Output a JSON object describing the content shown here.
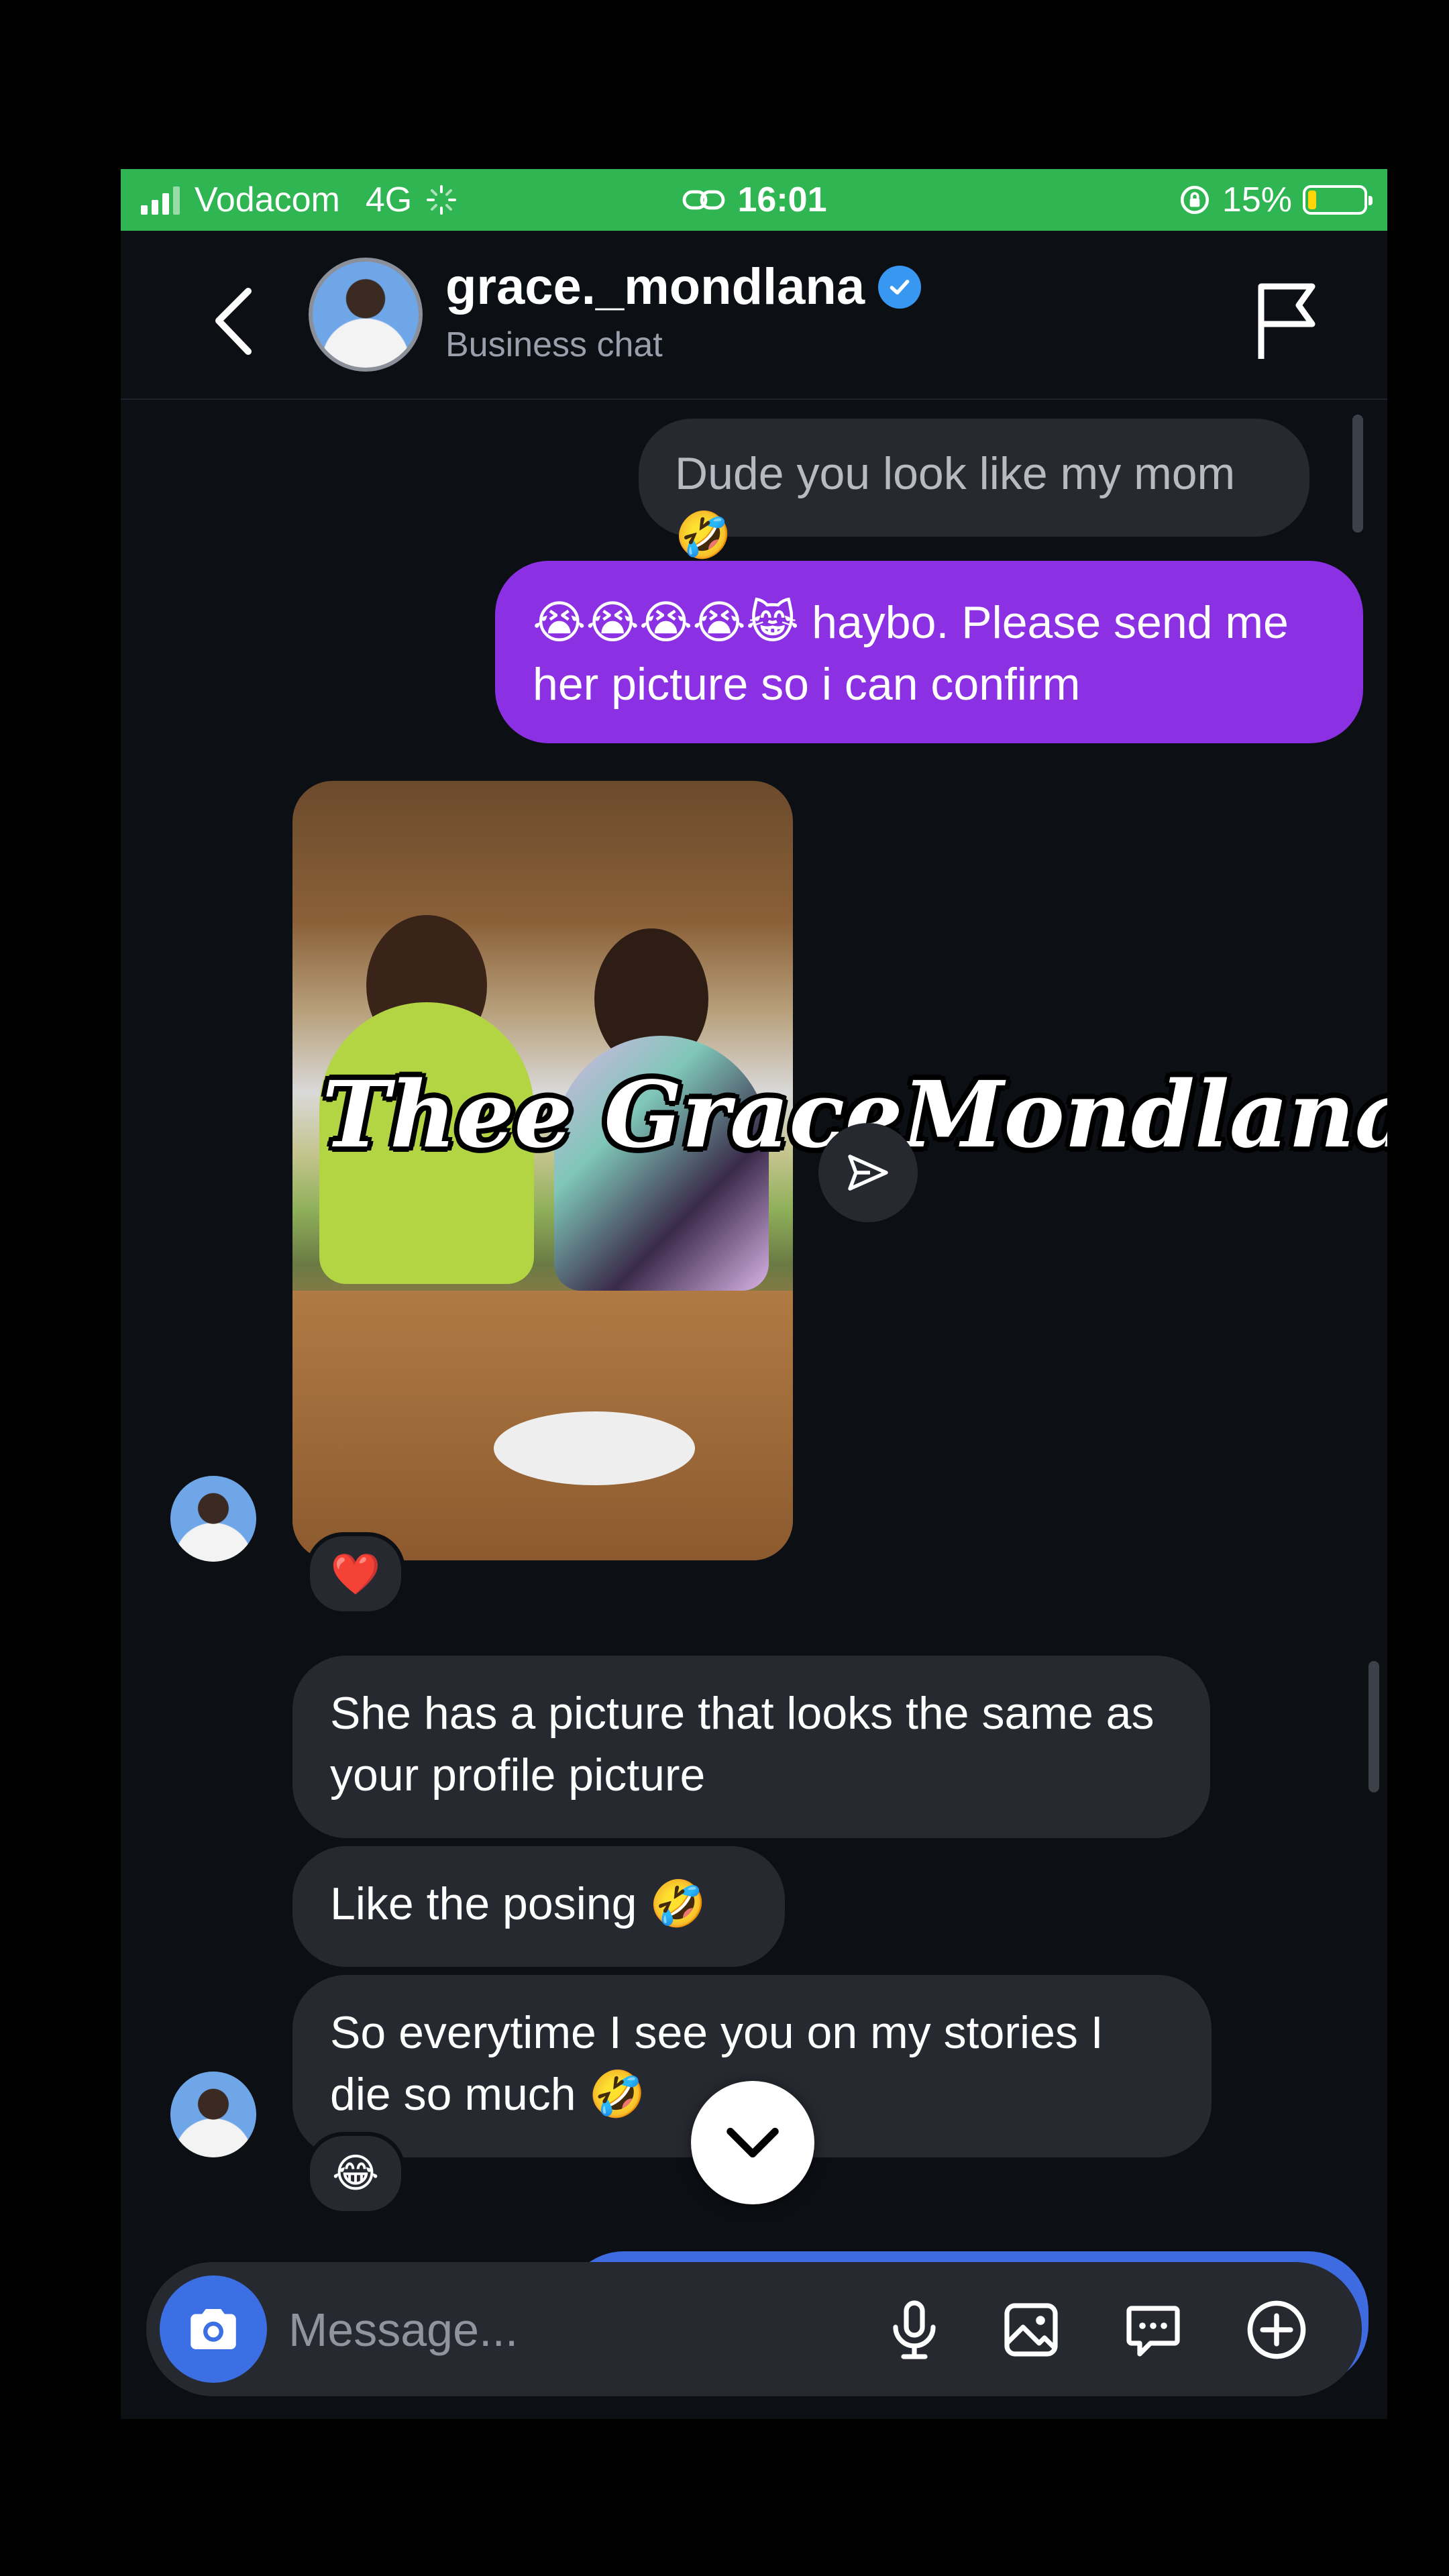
{
  "status_bar": {
    "carrier": "Vodacom",
    "network": "4G",
    "time": "16:01",
    "battery": "15%",
    "battery_level": 0.15,
    "bar_color": "#2fb652"
  },
  "header": {
    "username": "grace._mondlana",
    "subtitle": "Business chat",
    "verified": true
  },
  "messages": {
    "m1": "Dude you look like my mom🤣",
    "m2": "😭😭😭😭😹 haybo. Please send me her picture so i can confirm",
    "photo_caption": "Thee GraceMondlana🥰",
    "photo_reaction": "❤️",
    "m3": "She has a picture that looks the same as your profile picture",
    "m4": "Like the posing 🤣",
    "m5": "So everytime I see you on my stories I die so much 🤣",
    "m5_reaction": "😂"
  },
  "composer": {
    "placeholder": "Message..."
  },
  "colors": {
    "outgoing": "#8b31e3",
    "incoming": "#262930",
    "accent": "#3b6fe3",
    "background": "#0c0f14"
  },
  "icons": [
    "back-icon",
    "verified-icon",
    "flag-icon",
    "share-icon",
    "chevron-down-icon",
    "camera-icon",
    "mic-icon",
    "gallery-icon",
    "sticker-icon",
    "plus-icon"
  ]
}
